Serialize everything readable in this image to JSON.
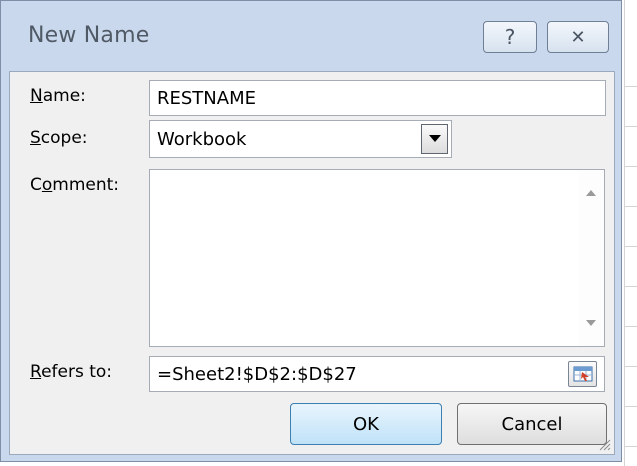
{
  "dialog": {
    "title": "New Name",
    "help_glyph": "?",
    "close_glyph": "✕"
  },
  "form": {
    "name_label_mnemonic": "N",
    "name_label_rest": "ame:",
    "name_value": "RESTNAME",
    "scope_label_mnemonic": "S",
    "scope_label_rest": "cope:",
    "scope_value": "Workbook",
    "comment_label_pre": "C",
    "comment_label_mnemonic": "o",
    "comment_label_rest": "mment:",
    "comment_value": "",
    "refers_label_mnemonic": "R",
    "refers_label_rest": "efers to:",
    "refers_value": "=Sheet2!$D$2:$D$27"
  },
  "buttons": {
    "ok": "OK",
    "cancel": "Cancel"
  },
  "icons": {
    "help": "help-icon",
    "close": "close-icon",
    "dropdown": "chevron-down-icon",
    "range_picker": "range-picker-icon",
    "resize": "resize-grip-icon"
  }
}
